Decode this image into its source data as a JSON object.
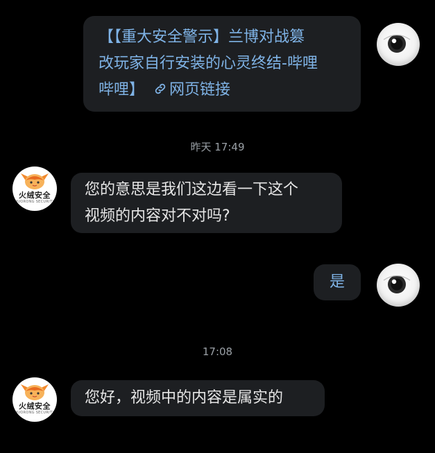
{
  "messages": [
    {
      "title_lines": [
        "【【重大安全警示】兰博对战篡",
        "改玩家自行安装的心灵终结-哔哩",
        "哔哩】"
      ],
      "link_label": "网页链接"
    },
    {
      "text_lines": [
        "您的意思是我们这边看一下这个",
        "视频的内容对不对吗?"
      ]
    },
    {
      "text": "是"
    },
    {
      "text": "您好，视频中的内容是属实的"
    }
  ],
  "timestamps": [
    "昨天 17:49",
    "17:08"
  ],
  "contact": {
    "brand_name": "火绒安全",
    "brand_sub": "HUORONG SECURITY"
  },
  "colors": {
    "background": "#000000",
    "bubble": "#1d1f22",
    "link": "#7fb3e6"
  },
  "icons": {
    "link": "link-icon",
    "self_avatar": "eyeball-avatar"
  }
}
